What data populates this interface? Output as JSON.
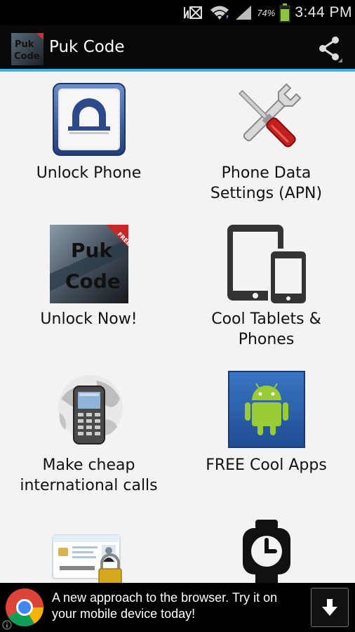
{
  "status_bar": {
    "battery_percent": "74%",
    "time": "3:44 PM",
    "icons": [
      "no-sim-icon",
      "wifi-icon",
      "signal-icon",
      "battery-icon"
    ]
  },
  "action_bar": {
    "title": "Puk Code",
    "app_icon_text": [
      "Puk",
      "Code"
    ],
    "share_icon": "share-icon",
    "accent_color": "#33b5e5"
  },
  "grid": {
    "items": [
      {
        "label_lines": [
          "Unlock Phone"
        ],
        "icon": "padlock-icon"
      },
      {
        "label_lines": [
          "Phone Data",
          "Settings (APN)"
        ],
        "icon": "tools-icon"
      },
      {
        "label_lines": [
          "Unlock Now!"
        ],
        "icon": "puk-code-icon",
        "icon_text": [
          "Puk",
          "Code",
          "FREE"
        ]
      },
      {
        "label_lines": [
          "Cool Tablets &",
          "Phones"
        ],
        "icon": "devices-icon"
      },
      {
        "label_lines": [
          "Make cheap",
          "international calls"
        ],
        "icon": "globe-phone-icon"
      },
      {
        "label_lines": [
          "FREE Cool Apps"
        ],
        "icon": "android-icon"
      },
      {
        "label_lines": [],
        "icon": "id-card-lock-icon"
      },
      {
        "label_lines": [],
        "icon": "smartwatch-icon"
      }
    ]
  },
  "ad_banner": {
    "text": "A new approach to the browser. Try it on your mobile device today!",
    "logo": "chrome-icon",
    "button_icon": "download-icon",
    "info_icon": "info-icon"
  }
}
